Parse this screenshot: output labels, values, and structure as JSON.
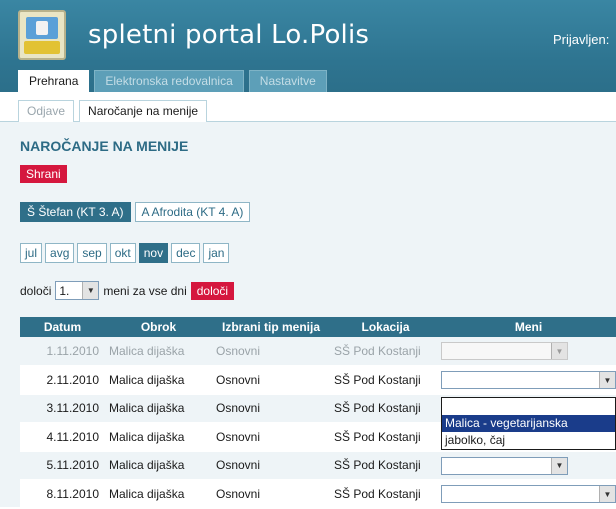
{
  "header": {
    "title": "spletni portal Lo.Polis",
    "login_text": "Prijavljen:",
    "logo_text": "LOPOLIS",
    "main_tabs": [
      {
        "label": "Prehrana",
        "active": true
      },
      {
        "label": "Elektronska redovalnica",
        "active": false
      },
      {
        "label": "Nastavitve",
        "active": false
      }
    ]
  },
  "sub_tabs": [
    {
      "label": "Odjave",
      "active": false
    },
    {
      "label": "Naročanje na menije",
      "active": true
    }
  ],
  "page": {
    "title": "NAROČANJE NA MENIJE",
    "save_label": "Shrani"
  },
  "students": [
    {
      "label": "Š Štefan (KT 3. A)",
      "active": true
    },
    {
      "label": "A Afrodita (KT 4. A)",
      "active": false
    }
  ],
  "months": [
    {
      "label": "jul",
      "active": false
    },
    {
      "label": "avg",
      "active": false
    },
    {
      "label": "sep",
      "active": false
    },
    {
      "label": "okt",
      "active": false
    },
    {
      "label": "nov",
      "active": true
    },
    {
      "label": "dec",
      "active": false
    },
    {
      "label": "jan",
      "active": false
    }
  ],
  "bulk": {
    "prefix": "določi",
    "value": "1.",
    "suffix": "meni za vse dni",
    "button": "določi"
  },
  "table": {
    "headers": [
      "Datum",
      "Obrok",
      "Izbrani tip menija",
      "Lokacija",
      "Meni"
    ],
    "rows": [
      {
        "date": "1.11.2010",
        "meal": "Malica dijaška",
        "type": "Osnovni",
        "location": "SŠ Pod Kostanji",
        "menu": "",
        "disabled": true
      },
      {
        "date": "2.11.2010",
        "meal": "Malica dijaška",
        "type": "Osnovni",
        "location": "SŠ Pod Kostanji",
        "menu": "",
        "disabled": false
      },
      {
        "date": "3.11.2010",
        "meal": "Malica dijaška",
        "type": "Osnovni",
        "location": "SŠ Pod Kostanji",
        "menu": "",
        "disabled": false
      },
      {
        "date": "4.11.2010",
        "meal": "Malica dijaška",
        "type": "Osnovni",
        "location": "SŠ Pod Kostanji",
        "menu": "",
        "disabled": false
      },
      {
        "date": "5.11.2010",
        "meal": "Malica dijaška",
        "type": "Osnovni",
        "location": "SŠ Pod Kostanji",
        "menu": "",
        "disabled": false
      },
      {
        "date": "8.11.2010",
        "meal": "Malica dijaška",
        "type": "Osnovni",
        "location": "SŠ Pod Kostanji",
        "menu": "",
        "disabled": false
      }
    ]
  },
  "dropdown_options": [
    {
      "label": "",
      "selected": false
    },
    {
      "label": "Malica - vegetarijanska",
      "selected": true
    },
    {
      "label": "jabolko, čaj",
      "selected": false
    }
  ],
  "colors": {
    "header_bg": "#2e7490",
    "accent_red": "#d5173e",
    "table_header": "#2f6f89",
    "selected_option": "#1a3c8a"
  }
}
